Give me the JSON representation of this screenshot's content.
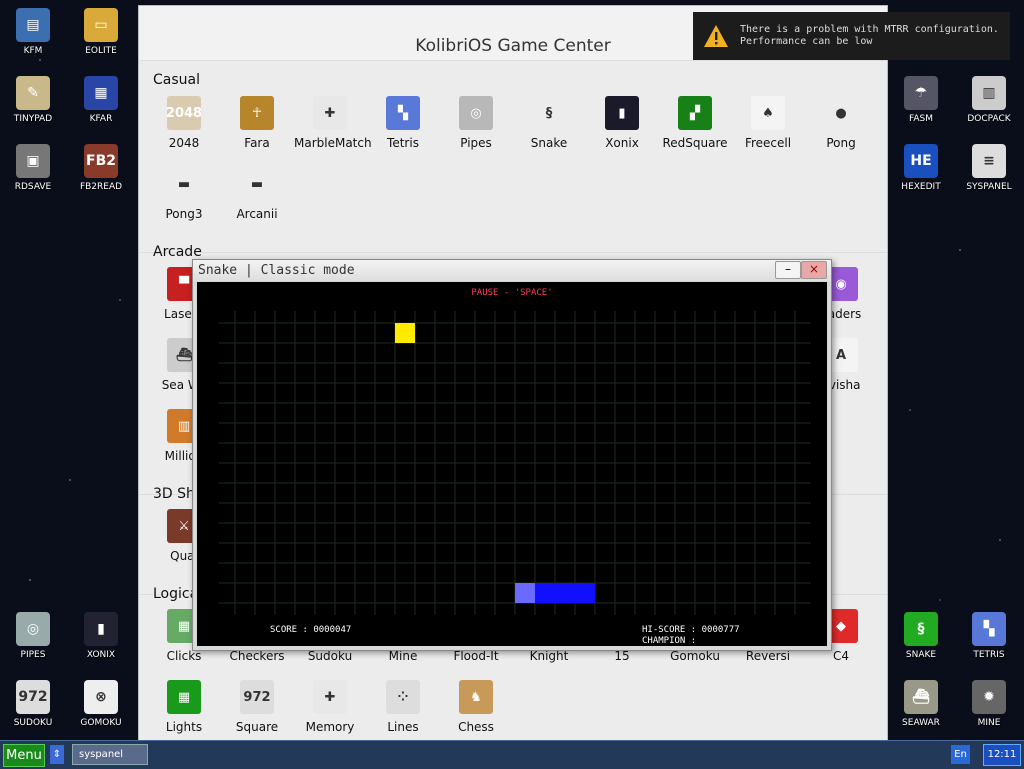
{
  "desktop_left": [
    {
      "label": "KFM",
      "icon": "floppy-disk-icon",
      "glyph": "▤",
      "color": "#3b6fb0"
    },
    {
      "label": "EOLITE",
      "icon": "folder-icon",
      "glyph": "▭",
      "color": "#d9a93a"
    },
    {
      "label": "TINYPAD",
      "icon": "notepad-icon",
      "glyph": "✎",
      "color": "#c9b98a"
    },
    {
      "label": "KFAR",
      "icon": "kfar-icon",
      "glyph": "▦",
      "color": "#2946a6"
    },
    {
      "label": "RDSAVE",
      "icon": "ram-disk-icon",
      "glyph": "▣",
      "color": "#777"
    },
    {
      "label": "FB2READ",
      "icon": "book-icon",
      "glyph": "FB2",
      "color": "#8a3a2a"
    },
    {
      "label": "PIPES",
      "icon": "pipes-icon",
      "glyph": "◎",
      "color": "#9aa"
    },
    {
      "label": "XONIX",
      "icon": "xonix-icon",
      "glyph": "▮",
      "color": "#223"
    },
    {
      "label": "SUDOKU",
      "icon": "sudoku-icon",
      "glyph": "972",
      "color": "#ddd"
    },
    {
      "label": "GOMOKU",
      "icon": "gomoku-icon",
      "glyph": "⊗",
      "color": "#eee"
    }
  ],
  "desktop_right": [
    {
      "label": "FASM",
      "icon": "fasm-icon",
      "glyph": "☂",
      "color": "#556"
    },
    {
      "label": "DOCPACK",
      "icon": "docpack-icon",
      "glyph": "▥",
      "color": "#ccc"
    },
    {
      "label": "HEXEDIT",
      "icon": "hex-edit-icon",
      "glyph": "HE",
      "color": "#1a4fc0"
    },
    {
      "label": "SYSPANEL",
      "icon": "sys-panel-icon",
      "glyph": "≡",
      "color": "#ddd"
    },
    {
      "label": "SNAKE",
      "icon": "snake-icon",
      "glyph": "§",
      "color": "#2a2"
    },
    {
      "label": "TETRIS",
      "icon": "tetris-icon",
      "glyph": "▚",
      "color": "#5878d8"
    },
    {
      "label": "SEAWAR",
      "icon": "seawar-icon",
      "glyph": "⛴",
      "color": "#998"
    },
    {
      "label": "MINE",
      "icon": "mine-icon",
      "glyph": "✹",
      "color": "#666"
    }
  ],
  "game_center": {
    "title": "KolibriOS Game Center",
    "sections": {
      "casual": "Casual",
      "arcade": "Arcade",
      "shooters": "3D Sh",
      "logical": "Logica"
    },
    "casual": [
      {
        "label": "2048",
        "icon": "2048-icon",
        "glyph": "2048",
        "color": "#d8cbb0"
      },
      {
        "label": "Fara",
        "icon": "fara-icon",
        "glyph": "☥",
        "color": "#b8862a"
      },
      {
        "label": "MarbleMatch",
        "icon": "gamepad-icon",
        "glyph": "✚",
        "color": "#e8e8e8"
      },
      {
        "label": "Tetris",
        "icon": "tetris-icon",
        "glyph": "▚",
        "color": "#5a78d8"
      },
      {
        "label": "Pipes",
        "icon": "pipes-icon",
        "glyph": "◎",
        "color": "#b8b8b8"
      },
      {
        "label": "Snake",
        "icon": "snake-icon",
        "glyph": "§",
        "color": "#ececec"
      },
      {
        "label": "Xonix",
        "icon": "xonix-icon",
        "glyph": "▮",
        "color": "#1a1a2a"
      },
      {
        "label": "RedSquare",
        "icon": "redsquare-icon",
        "glyph": "▞",
        "color": "#178017"
      },
      {
        "label": "Freecell",
        "icon": "cards-icon",
        "glyph": "♠",
        "color": "#f4f4f4"
      },
      {
        "label": "Pong",
        "icon": "ball-icon",
        "glyph": "●",
        "color": "#ececec"
      },
      {
        "label": "Pong3",
        "icon": "paddle-icon",
        "glyph": "▬",
        "color": "#ececec"
      },
      {
        "label": "Arcanii",
        "icon": "paddle-icon",
        "glyph": "▬",
        "color": "#ececec"
      }
    ],
    "arcade": [
      {
        "label": "LaserT",
        "icon": "tank-icon",
        "glyph": "▀",
        "color": "#c62020"
      },
      {
        "label": "vaders",
        "icon": "ufo-icon",
        "glyph": "◉",
        "color": "#9a5ad8"
      },
      {
        "label": "Sea Wa",
        "icon": "ship-icon",
        "glyph": "⛴",
        "color": "#ccc"
      },
      {
        "label": "avisha",
        "icon": "keyboard-icon",
        "glyph": "A",
        "color": "#f4f4f4"
      },
      {
        "label": "Million",
        "icon": "million-icon",
        "glyph": "▥",
        "color": "#d07a2a"
      }
    ],
    "shooters": [
      {
        "label": "Qual",
        "icon": "quake-icon",
        "glyph": "⚔",
        "color": "#7a3a2a"
      }
    ],
    "logical": [
      {
        "label": "Clicks",
        "icon": "clicks-icon",
        "glyph": "▦",
        "color": "#6a6"
      },
      {
        "label": "Checkers",
        "icon": "checkers-icon",
        "glyph": "",
        "color": "#ececec"
      },
      {
        "label": "Sudoku",
        "icon": "sudoku-icon",
        "glyph": "",
        "color": "#ececec"
      },
      {
        "label": "Mine",
        "icon": "mine-icon",
        "glyph": "",
        "color": "#ececec"
      },
      {
        "label": "Flood-It",
        "icon": "flood-icon",
        "glyph": "",
        "color": "#ececec"
      },
      {
        "label": "Knight",
        "icon": "knight-icon",
        "glyph": "",
        "color": "#ececec"
      },
      {
        "label": "15",
        "icon": "fifteen-icon",
        "glyph": "",
        "color": "#ececec"
      },
      {
        "label": "Gomoku",
        "icon": "gomoku-icon",
        "glyph": "",
        "color": "#ececec"
      },
      {
        "label": "Reversi",
        "icon": "reversi-icon",
        "glyph": "",
        "color": "#ececec"
      },
      {
        "label": "C4",
        "icon": "c4-icon",
        "glyph": "◆",
        "color": "#e02a2a"
      },
      {
        "label": "Lights",
        "icon": "lights-icon",
        "glyph": "▦",
        "color": "#1a9a1a"
      },
      {
        "label": "Square",
        "icon": "square-icon",
        "glyph": "972",
        "color": "#ddd"
      },
      {
        "label": "Memory",
        "icon": "gamepad-icon",
        "glyph": "✚",
        "color": "#e8e8e8"
      },
      {
        "label": "Lines",
        "icon": "lines-icon",
        "glyph": "⁘",
        "color": "#ddd"
      },
      {
        "label": "Chess",
        "icon": "chess-knight-icon",
        "glyph": "♞",
        "color": "#c89a5a"
      }
    ]
  },
  "snake": {
    "title": "Snake | Classic mode",
    "minimize": "–",
    "close": "×",
    "pause": "PAUSE - 'SPACE'",
    "score": "SCORE : 0000047",
    "hiscore": "HI-SCORE : 0000777",
    "champion": "CHAMPION :",
    "colors": {
      "food": "#ffea00",
      "head": "#6a6aff",
      "body": "#1010ff",
      "pause": "#ff3a5a",
      "grid": "#1e2a1e"
    },
    "food": {
      "col": 8,
      "row": 0
    },
    "snake_cells": [
      {
        "col": 14,
        "row": 13
      },
      {
        "col": 15,
        "row": 13
      },
      {
        "col": 16,
        "row": 13
      },
      {
        "col": 17,
        "row": 13
      }
    ]
  },
  "toast": {
    "icon": "warning-icon",
    "line1": "There is a problem with MTRR configuration.",
    "line2": "Performance can be low"
  },
  "taskbar": {
    "menu": "Menu",
    "task": "syspanel",
    "lang": "En",
    "clock": "12:11"
  }
}
